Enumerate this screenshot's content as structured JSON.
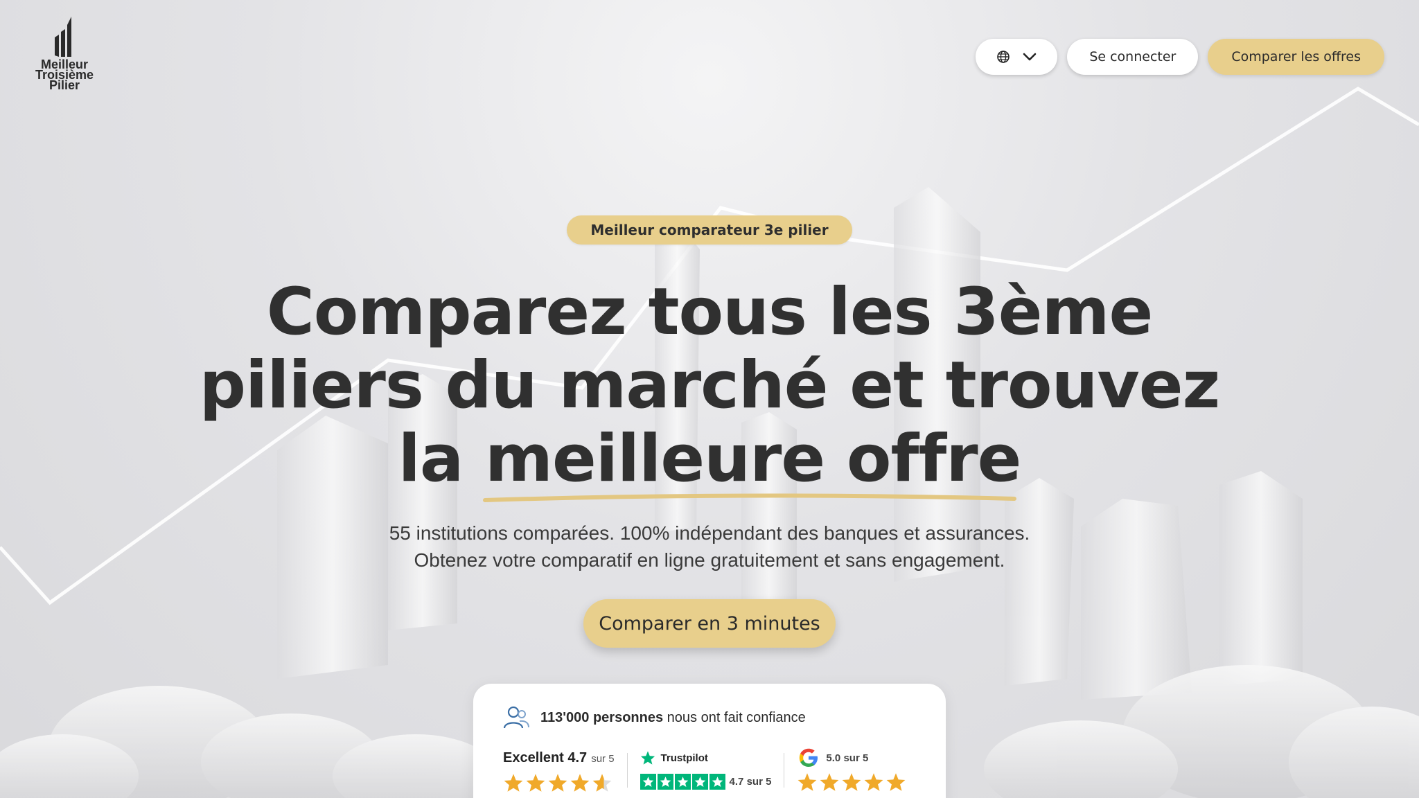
{
  "brand": {
    "logo_lines": [
      "Meilleur",
      "Troisième",
      "Pilier"
    ]
  },
  "nav": {
    "login_label": "Se connecter",
    "cta_label": "Comparer les offres",
    "language_icon": "globe-icon",
    "chevron_icon": "chevron-down-icon"
  },
  "hero": {
    "badge": "Meilleur comparateur 3e pilier",
    "headline_lines": [
      "Comparez tous les 3ème",
      "piliers du marché et trouvez",
      "la meilleure offre"
    ],
    "sub_lines": [
      "55 institutions comparées. 100% indépendant des banques et assurances.",
      "Obtenez votre comparatif en ligne gratuitement et sans engagement."
    ],
    "cta_label": "Comparer en 3 minutes"
  },
  "trust": {
    "count": "113'000 personnes",
    "count_suffix": "nous ont fait confiance",
    "overall_label": "Excellent 4.7",
    "overall_suffix": "sur 5",
    "overall_rating": 4.7,
    "trustpilot_label": "Trustpilot",
    "trustpilot_score": "4.7 sur 5",
    "trustpilot_rating": 4.7,
    "google_score": "5.0 sur 5",
    "google_rating": 5.0
  },
  "colors": {
    "accent": "#e8cf8c",
    "text": "#303030",
    "star_gold": "#f0a92a",
    "trustpilot_green": "#00b67a"
  }
}
